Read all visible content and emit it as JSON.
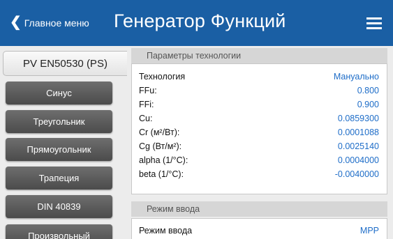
{
  "header": {
    "back_label": "Главное меню",
    "title": "Генератор Функций"
  },
  "sidebar": {
    "items": [
      {
        "label": "PV EN50530 (PS)",
        "active": true
      },
      {
        "label": "Синус"
      },
      {
        "label": "Треугольник"
      },
      {
        "label": "Прямоугольник"
      },
      {
        "label": "Трапеция"
      },
      {
        "label": "DIN 40839"
      },
      {
        "label": "Произвольный"
      }
    ]
  },
  "tech_section": {
    "title": "Параметры технологии",
    "rows": [
      {
        "label": "Технология",
        "value": "Мануально"
      },
      {
        "label": "FFu:",
        "value": "0.800"
      },
      {
        "label": "FFi:",
        "value": "0.900"
      },
      {
        "label": "Cu:",
        "value": "0.0859300"
      },
      {
        "label": "Cr (м²/Вт):",
        "value": "0.0001088"
      },
      {
        "label": "Cg (Вт/м²):",
        "value": "0.0025140"
      },
      {
        "label": "alpha (1/°C):",
        "value": "0.0004000"
      },
      {
        "label": "beta (1/°C):",
        "value": "-0.0040000"
      }
    ]
  },
  "input_section": {
    "title": "Режим ввода",
    "rows": [
      {
        "label": "Режим ввода",
        "value": "MPP"
      }
    ]
  }
}
